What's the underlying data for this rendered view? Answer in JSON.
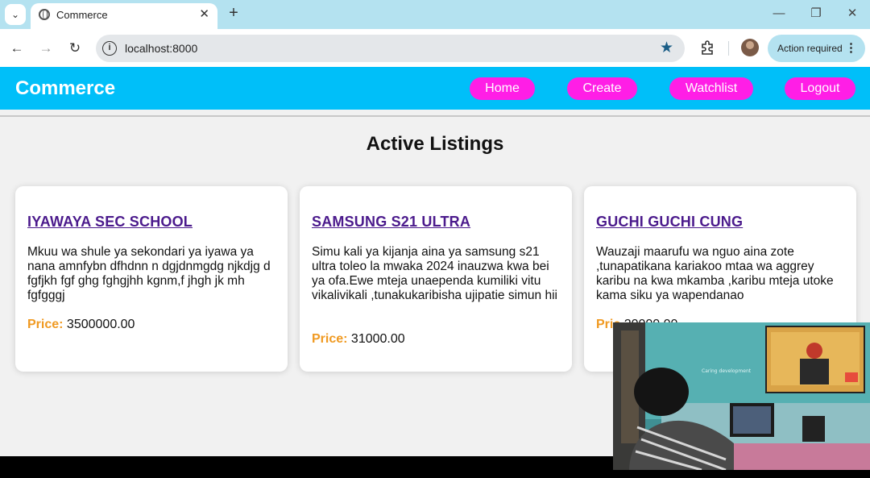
{
  "browser": {
    "tab_title": "Commerce",
    "url": "localhost:8000",
    "action_label": "Action required"
  },
  "header": {
    "brand": "Commerce",
    "nav": [
      "Home",
      "Create",
      "Watchlist",
      "Logout"
    ]
  },
  "page": {
    "title": "Active Listings"
  },
  "listings": [
    {
      "title": "IYAWAYA SEC SCHOOL",
      "description": "Mkuu wa shule ya sekondari ya iyawa ya nana amnfybn dfhdnn n dgjdnmgdg njkdjg d fgfjkh fgf ghg fghgjhh kgnm,f jhgh jk mh fgfgggj",
      "price_label": "Price:",
      "price": "3500000.00"
    },
    {
      "title": "SAMSUNG S21 ULTRA",
      "description": "Simu kali ya kijanja aina ya samsung s21 ultra toleo la mwaka 2024 inauzwa kwa bei ya ofa.Ewe mteja unaependa kumiliki vitu vikalivikali ,tunakukaribisha ujipatie simun hii",
      "price_label": "Price:",
      "price": "31000.00"
    },
    {
      "title": "GUCHI GUCHI CUNG",
      "description": "Wauzaji maarufu wa nguo aina zote ,tunapatikana kariakoo mtaa wa aggrey karibu na kwa mkamba ,karibu mteja utoke kama siku ya wapendanao",
      "price_label": "Pric",
      "price": "20000.00"
    }
  ],
  "webcam": {
    "tv_caption": "Caring development"
  },
  "colors": {
    "header": "#00bff9",
    "nav_pill": "#ff1ee6",
    "link": "#4b1a8c",
    "price_label": "#f09a22"
  }
}
